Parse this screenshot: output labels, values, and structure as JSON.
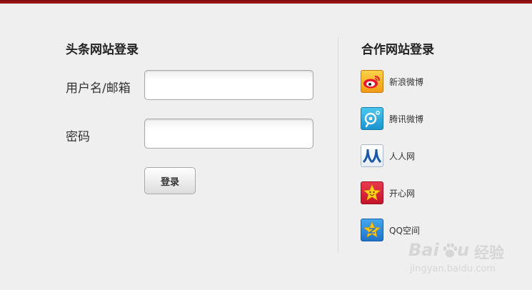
{
  "login": {
    "title": "头条网站登录",
    "username_label": "用户名/邮箱",
    "username_value": "",
    "password_label": "密码",
    "password_value": "",
    "submit_label": "登录"
  },
  "partners": {
    "title": "合作网站登录",
    "items": [
      {
        "label": "新浪微博",
        "icon": "sina-weibo-icon"
      },
      {
        "label": "腾讯微博",
        "icon": "tencent-weibo-icon"
      },
      {
        "label": "人人网",
        "icon": "renren-icon"
      },
      {
        "label": "开心网",
        "icon": "kaixin-icon"
      },
      {
        "label": "QQ空间",
        "icon": "qzone-icon"
      }
    ]
  },
  "watermark": {
    "brand_latin_a": "Bai",
    "brand_latin_b": "u",
    "brand_cn": "经验",
    "url": "jingyan.baidu.com"
  },
  "colors": {
    "top_bar": "#8b1010",
    "background": "#efefef"
  }
}
